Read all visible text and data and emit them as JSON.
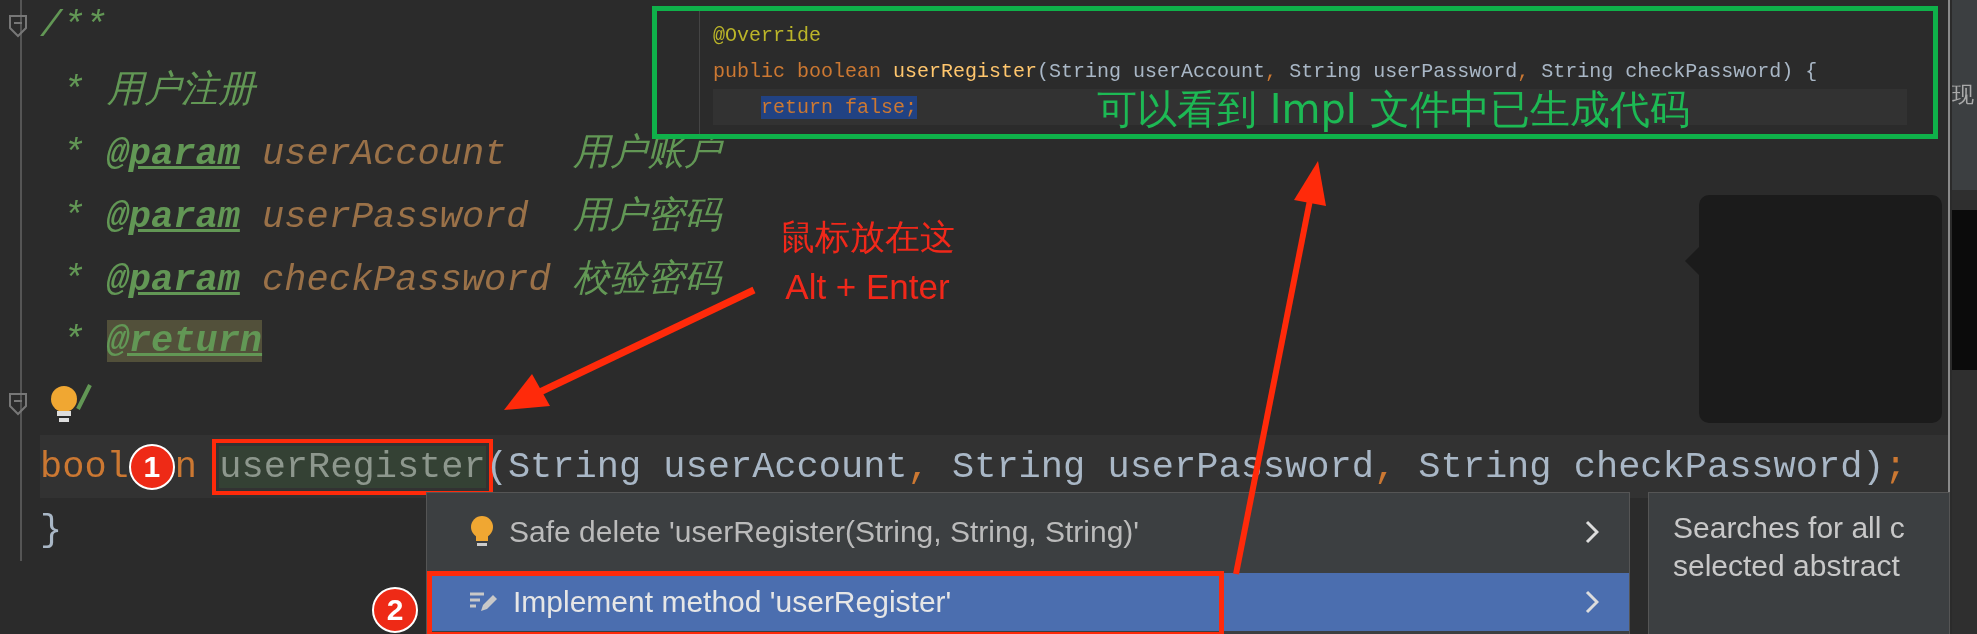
{
  "editor": {
    "comment_lines": [
      [
        {
          "text": "/**",
          "kind": "comment"
        }
      ],
      [
        {
          "text": " * ",
          "kind": "comment"
        },
        {
          "text": "用户注册",
          "kind": "comment"
        }
      ],
      [
        {
          "text": " * ",
          "kind": "comment"
        },
        {
          "text": "@param",
          "kind": "tag"
        },
        {
          "text": " userAccount   ",
          "kind": "param"
        },
        {
          "text": "用户账户",
          "kind": "comment"
        }
      ],
      [
        {
          "text": " * ",
          "kind": "comment"
        },
        {
          "text": "@param",
          "kind": "tag"
        },
        {
          "text": " userPassword  ",
          "kind": "param"
        },
        {
          "text": "用户密码",
          "kind": "comment"
        }
      ],
      [
        {
          "text": " * ",
          "kind": "comment"
        },
        {
          "text": "@param",
          "kind": "tag"
        },
        {
          "text": " checkPassword ",
          "kind": "param"
        },
        {
          "text": "校验密码",
          "kind": "comment"
        }
      ],
      [
        {
          "text": " * ",
          "kind": "comment"
        },
        {
          "text": "@return",
          "kind": "tag-highlighted"
        }
      ]
    ],
    "signature": [
      {
        "kind": "code",
        "tokens": [
          {
            "text": "bool",
            "kind": "keyword"
          }
        ]
      },
      {
        "kind": "badge",
        "text": "1"
      },
      {
        "kind": "code",
        "tokens": [
          {
            "text": "n ",
            "kind": "keyword"
          }
        ]
      },
      {
        "kind": "framed",
        "text": "userRegister"
      },
      {
        "kind": "code",
        "tokens": [
          {
            "text": "(String userAccount",
            "kind": "plain"
          },
          {
            "text": ",",
            "kind": "punct"
          },
          {
            "text": " String userPassword",
            "kind": "plain"
          },
          {
            "text": ",",
            "kind": "punct"
          },
          {
            "text": " String checkPassword)",
            "kind": "plain"
          },
          {
            "text": ";",
            "kind": "punct"
          }
        ]
      }
    ],
    "closing_line": [
      {
        "text": "}",
        "kind": "plain"
      }
    ]
  },
  "impl_preview": {
    "lines": [
      [
        {
          "text": "@Override",
          "kind": "annotation"
        }
      ],
      [
        {
          "text": "public boolean ",
          "kind": "keyword"
        },
        {
          "text": "userRegister",
          "kind": "method"
        },
        {
          "text": "(String userAccount",
          "kind": "plain"
        },
        {
          "text": ",",
          "kind": "punct"
        },
        {
          "text": " String userPassword",
          "kind": "plain"
        },
        {
          "text": ",",
          "kind": "punct"
        },
        {
          "text": " String checkPassword) {",
          "kind": "plain"
        }
      ],
      [
        {
          "text": "return false;",
          "kind": "selected"
        }
      ]
    ],
    "caption": "可以看到 Impl 文件中已生成代码"
  },
  "hint": [
    "鼠标放在这",
    "Alt + Enter"
  ],
  "intention_menu": {
    "badge": "2",
    "items": [
      {
        "label": "Safe delete 'userRegister(String, String, String)'",
        "kind": "bulb",
        "selected": false
      },
      {
        "label": "Implement method 'userRegister'",
        "kind": "edit",
        "selected": true
      }
    ]
  },
  "doc_popup": {
    "lines": [
      "Searches for all c",
      "selected abstract"
    ]
  },
  "side_window": {
    "text": "现"
  }
}
